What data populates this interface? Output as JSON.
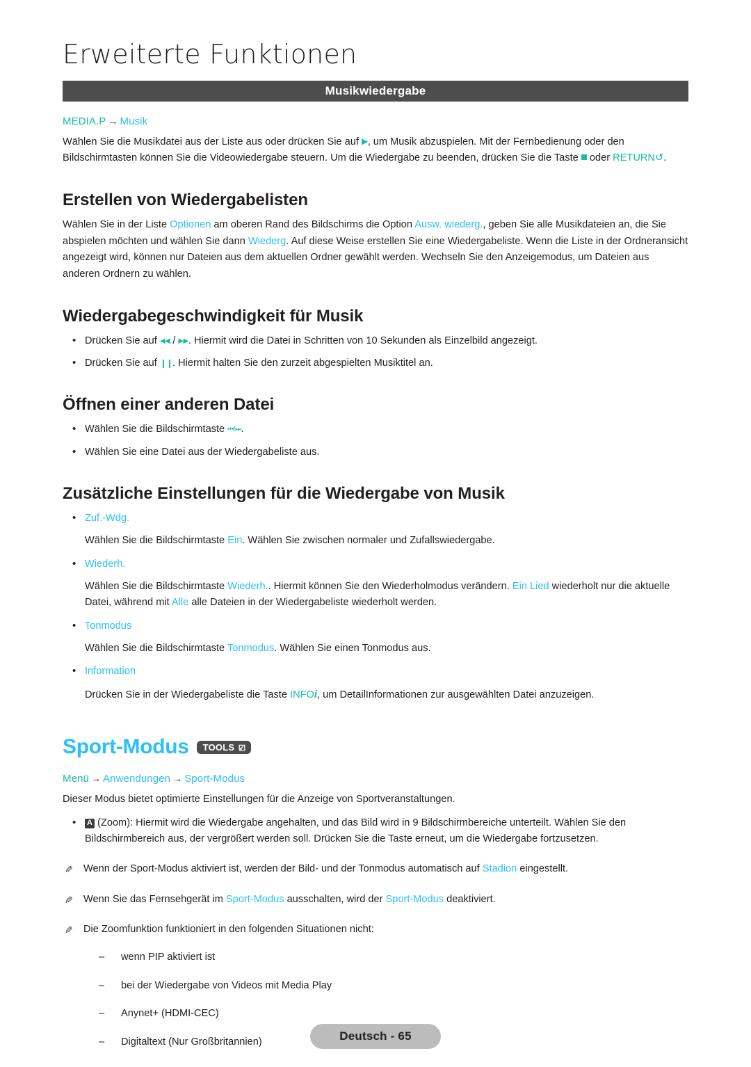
{
  "chapter": {
    "title": "Erweiterte Funktionen"
  },
  "section_band": {
    "title": "Musikwiedergabe"
  },
  "breadcrumb_media": {
    "root": "MEDIA.P",
    "arrow": "→",
    "leaf": "Musik"
  },
  "intro": {
    "p1_a": "Wählen Sie die Musikdatei aus der Liste aus oder drücken Sie auf ",
    "play_icon": "▶",
    "p1_b": ", um Musik abzuspielen. Mit der Fernbedienung oder den Bildschirmtasten können Sie die Videowiedergabe steuern. Um die Wiedergabe zu beenden, drücken Sie die Taste ",
    "stop_icon": "■",
    "p1_c": " oder ",
    "return_key": "RETURN",
    "return_glyph": "↺",
    "p1_d": "."
  },
  "playlists": {
    "heading": "Erstellen von Wiedergabelisten",
    "t1": "Wählen Sie in der Liste ",
    "link1": "Optionen",
    "t2": " am oberen Rand des Bildschirms die Option ",
    "link2": "Ausw. wiederg.",
    "t3": ", geben Sie alle Musikdateien an, die Sie abspielen möchten und wählen Sie dann ",
    "link3": "Wiederg",
    "t4": ". Auf diese Weise erstellen Sie eine Wiedergabeliste. Wenn die Liste in der Ordneransicht angezeigt wird, können nur Dateien aus dem aktuellen Ordner gewählt werden. Wechseln Sie den Anzeigemodus, um Dateien aus anderen Ordnern zu wählen."
  },
  "speed": {
    "heading": "Wiedergabegeschwindigkeit für Musik",
    "b1_a": "Drücken Sie auf ",
    "b1_rew": "◀◀",
    "b1_sep": " / ",
    "b1_ff": "▶▶",
    "b1_b": ". Hiermit wird die Datei in Schritten von 10 Sekunden als Einzelbild angezeigt.",
    "b2_a": "Drücken Sie auf ",
    "b2_pause": "❙❙",
    "b2_b": ". Hiermit halten Sie den zurzeit abgespielten Musiktitel an."
  },
  "openfile": {
    "heading": "Öffnen einer anderen Datei",
    "b1_a": "Wählen Sie die Bildschirmtaste ",
    "b1_prev": "⏮",
    "b1_sep": "/",
    "b1_next": "⏭",
    "b1_b": ".",
    "b2": "Wählen Sie eine Datei aus der Wiedergabeliste aus."
  },
  "extra": {
    "heading": "Zusätzliche Einstellungen für die Wiedergabe von Musik",
    "item1_label": "Zuf.-Wdg.",
    "item1_t1": "Wählen Sie die Bildschirmtaste ",
    "item1_link": "Ein",
    "item1_t2": ". Wählen Sie zwischen normaler und Zufallswiedergabe.",
    "item2_label": "Wiederh.",
    "item2_t1": "Wählen Sie die Bildschirmtaste ",
    "item2_link1": "Wiederh.",
    "item2_t2": ". Hiermit können Sie den Wiederholmodus verändern. ",
    "item2_link2": "Ein Lied",
    "item2_t3": " wiederholt nur die aktuelle Datei, während mit ",
    "item2_link3": "Alle",
    "item2_t4": " alle Dateien in der Wiedergabeliste wiederholt werden.",
    "item3_label": "Tonmodus",
    "item3_t1": "Wählen Sie die Bildschirmtaste ",
    "item3_link": "Tonmodus",
    "item3_t2": ". Wählen Sie einen Tonmodus aus.",
    "item4_label": "Information",
    "item4_t1": "Drücken Sie in der Wiedergabeliste die Taste ",
    "item4_key": "INFO",
    "item4_key_i": "i",
    "item4_t2": ", um DetailInformationen zur ausgewählten Datei anzuzeigen."
  },
  "sport": {
    "heading": "Sport-Modus",
    "tools_label": "TOOLS",
    "crumb1": "Menü",
    "crumb_arrow": "→",
    "crumb2": "Anwendungen",
    "crumb3": "Sport-Modus",
    "intro": "Dieser Modus bietet optimierte Einstellungen für die Anzeige von Sportveranstaltungen.",
    "zoom_key": "A",
    "zoom_text": " (Zoom): Hiermit wird die Wiedergabe angehalten, und das Bild wird in 9 Bildschirmbereiche unterteilt. Wählen Sie den Bildschirmbereich aus, der vergrößert werden soll. Drücken Sie die Taste erneut, um die Wiedergabe fortzusetzen.",
    "note1_a": "Wenn der Sport-Modus aktiviert ist, werden der Bild- und der Tonmodus automatisch auf ",
    "note1_link": "Stadion",
    "note1_b": " eingestellt.",
    "note2_a": "Wenn Sie das Fernsehgerät im ",
    "note2_link1": "Sport-Modus",
    "note2_b": " ausschalten, wird der ",
    "note2_link2": "Sport-Modus",
    "note2_c": " deaktiviert.",
    "note3": "Die Zoomfunktion funktioniert in den folgenden Situationen nicht:",
    "sit1": "wenn PIP aktiviert ist",
    "sit2": "bei der Wiedergabe von Videos mit Media Play",
    "sit3": "Anynet+ (HDMI-CEC)",
    "sit4": "Digitaltext (Nur Großbritannien)"
  },
  "footer": {
    "page_label": "Deutsch - 65"
  },
  "colors": {
    "accent_blue": "#2dc0f2",
    "accent_green": "#19bda0",
    "band_gray": "#4d4d4d",
    "footer_gray": "#bcbcbc",
    "text": "#231f20"
  }
}
